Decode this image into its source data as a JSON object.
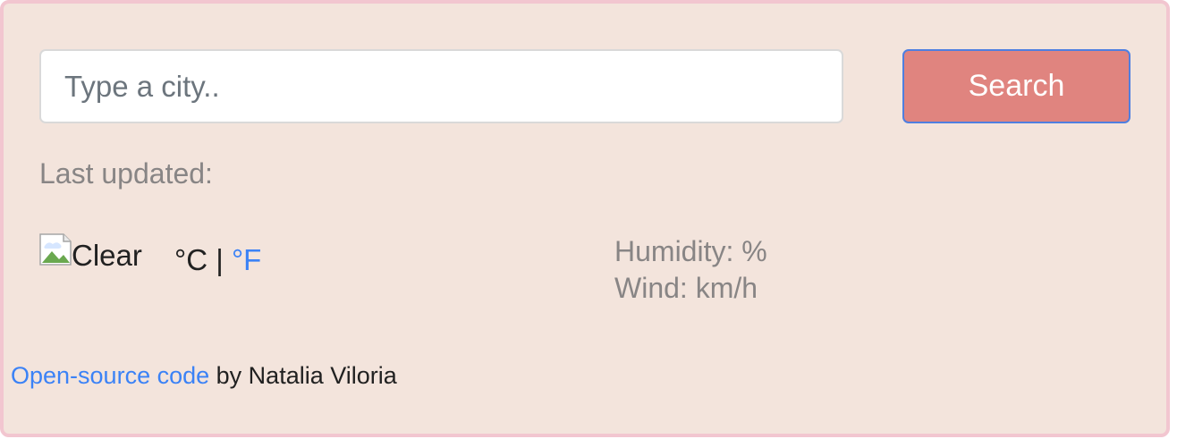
{
  "search": {
    "placeholder": "Type a city..",
    "value": "",
    "button_label": "Search"
  },
  "weather": {
    "last_updated_label": "Last updated:",
    "icon_alt": "Clear",
    "celsius_label": "°C",
    "separator": "|",
    "fahrenheit_label": "°F",
    "humidity_label": "Humidity: %",
    "wind_label": "Wind: km/h"
  },
  "footer": {
    "link_text": "Open-source code",
    "author_text": "by Natalia Viloria"
  },
  "colors": {
    "background": "#f3e4dc",
    "frame_border": "#f2c6d0",
    "button": "#e0847f",
    "link": "#3b82f6",
    "muted_text": "#888585"
  },
  "icons": {
    "weather_icon": "broken-image-icon"
  }
}
